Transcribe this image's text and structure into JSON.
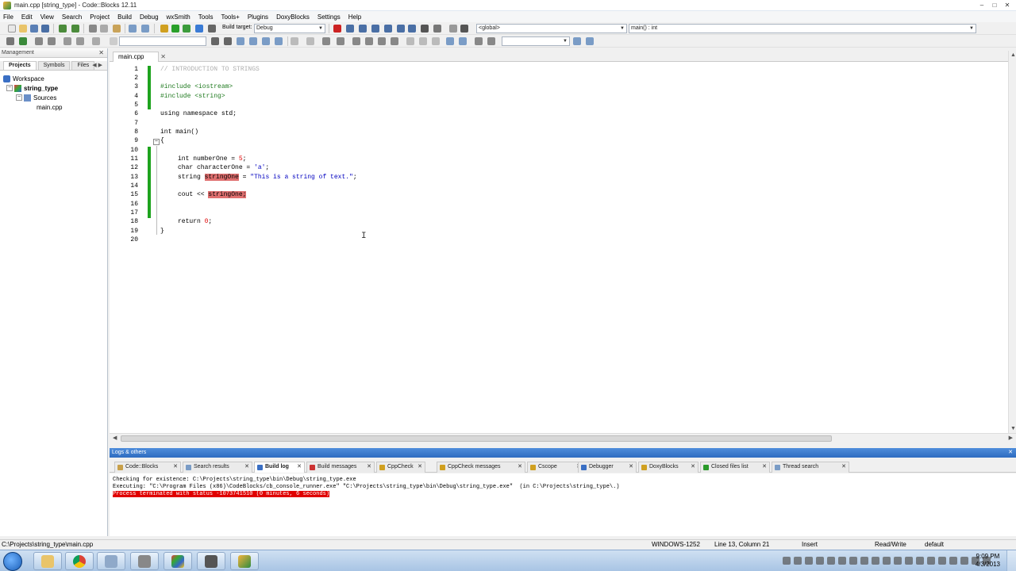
{
  "window": {
    "title": "main.cpp [string_type] - Code::Blocks 12.11"
  },
  "menu": [
    "File",
    "Edit",
    "View",
    "Search",
    "Project",
    "Build",
    "Debug",
    "wxSmith",
    "Tools",
    "Tools+",
    "Plugins",
    "DoxyBlocks",
    "Settings",
    "Help"
  ],
  "toolbar": {
    "build_target_label": "Build target:",
    "build_target_value": "Debug",
    "scope_value": "<global>",
    "function_value": "main() : int"
  },
  "management": {
    "header": "Management",
    "tabs": [
      "Projects",
      "Symbols",
      "Files"
    ],
    "tree": {
      "workspace": "Workspace",
      "project": "string_type",
      "folder": "Sources",
      "file": "main.cpp"
    }
  },
  "editor": {
    "tab": "main.cpp",
    "line_numbers": [
      "1",
      "2",
      "3",
      "4",
      "5",
      "6",
      "7",
      "8",
      "9",
      "10",
      "11",
      "12",
      "13",
      "14",
      "15",
      "16",
      "17",
      "18",
      "19",
      "20"
    ],
    "code": {
      "l1": "// INTRODUCTION TO STRINGS",
      "l3": "#include <iostream>",
      "l4": "#include <string>",
      "l6a": "using namespace std;",
      "l8": "int main()",
      "l9": "{",
      "l11a": "int numberOne = ",
      "l11b": "5",
      "l11c": ";",
      "l12a": "char characterOne = ",
      "l12b": "'a'",
      "l12c": ";",
      "l13a": "string ",
      "l13b": "stringOne",
      "l13c": " = ",
      "l13d": "\"This is a string of text.\"",
      "l13e": ";",
      "l15a": "cout << ",
      "l15b": "stringOne;",
      "l18a": "return ",
      "l18b": "0",
      "l18c": ";",
      "l19": "}"
    }
  },
  "logs": {
    "header": "Logs & others",
    "tabs": [
      "Code::Blocks",
      "Search results",
      "Build log",
      "Build messages",
      "CppCheck",
      "CppCheck messages",
      "Cscope",
      "Debugger",
      "DoxyBlocks",
      "Closed files list",
      "Thread search"
    ],
    "active_tab": "Build log",
    "lines": [
      "Checking for existence: C:\\Projects\\string_type\\bin\\Debug\\string_type.exe",
      "Executing: \"C:\\Program Files (x86)\\CodeBlocks/cb_console_runner.exe\" \"C:\\Projects\\string_type\\bin\\Debug\\string_type.exe\"  (in C:\\Projects\\string_type\\.)"
    ],
    "error_line": "Process terminated with status -1073741510 (0 minutes, 6 seconds)"
  },
  "statusbar": {
    "path": "C:\\Projects\\string_type\\main.cpp",
    "encoding": "WINDOWS-1252",
    "position": "Line 13, Column 21",
    "mode": "Insert",
    "access": "Read/Write",
    "lang": "default"
  },
  "taskbar": {
    "time": "9:09 PM",
    "date": "4/3/2013"
  }
}
